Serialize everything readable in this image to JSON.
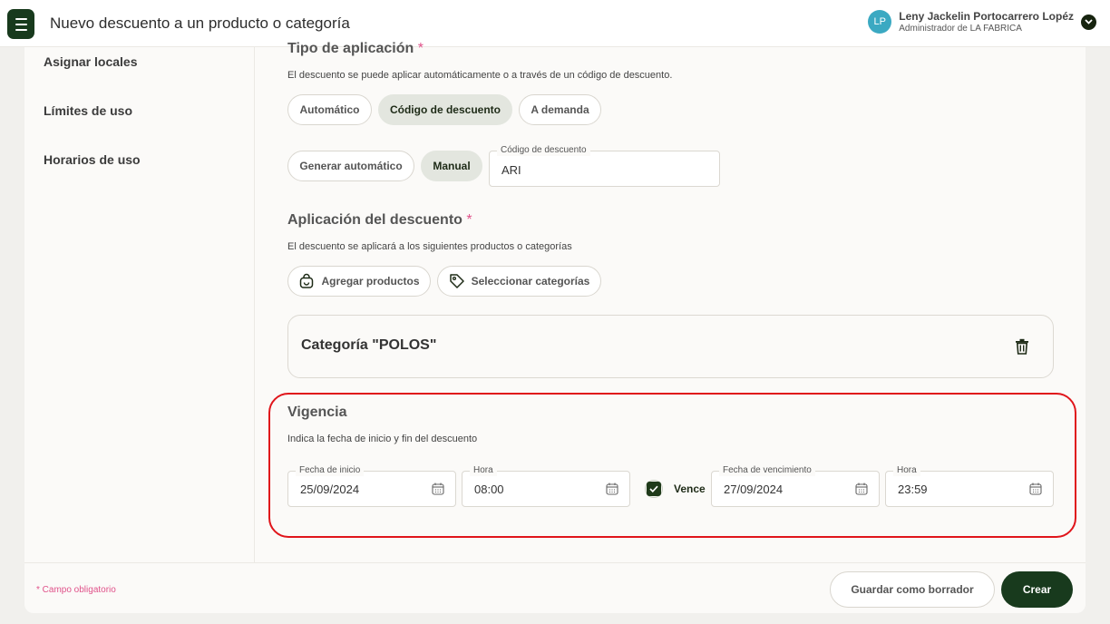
{
  "header": {
    "title": "Nuevo descuento a un producto o categoría",
    "user_initials": "LP",
    "user_name": "Leny Jackelin Portocarrero Lopéz",
    "user_role": "Administrador de LA FABRICA"
  },
  "sidebar": {
    "items": [
      {
        "label": "Asignar locales"
      },
      {
        "label": "Límites de uso"
      },
      {
        "label": "Horarios de uso"
      }
    ]
  },
  "tipo_aplicacion": {
    "title": "Tipo de aplicación",
    "required_mark": "*",
    "description": "El descuento se puede aplicar automáticamente o a través de un código de descuento.",
    "options": [
      "Automático",
      "Código de descuento",
      "A demanda"
    ],
    "selected": "Código de descuento",
    "code_modes": [
      "Generar automático",
      "Manual"
    ],
    "code_mode_selected": "Manual",
    "code_field_label": "Código de descuento",
    "code_field_value": "ARI"
  },
  "aplicacion": {
    "title": "Aplicación del descuento",
    "required_mark": "*",
    "description": "El descuento se aplicará a los siguientes productos o categorías",
    "add_products_label": "Agregar productos",
    "select_categories_label": "Seleccionar categorías",
    "selected_category": "Categoría \"POLOS\""
  },
  "vigencia": {
    "title": "Vigencia",
    "description": "Indica la fecha de inicio y fin del descuento",
    "start_date_label": "Fecha de inicio",
    "start_date_value": "25/09/2024",
    "start_time_label": "Hora",
    "start_time_value": "08:00",
    "expires_label": "Vence",
    "expires_checked": true,
    "end_date_label": "Fecha de vencimiento",
    "end_date_value": "27/09/2024",
    "end_time_label": "Hora",
    "end_time_value": "23:59"
  },
  "footer": {
    "required_note": "* Campo obligatorio",
    "save_draft_label": "Guardar como borrador",
    "create_label": "Crear"
  },
  "colors": {
    "primary": "#183a1d",
    "accent_pink": "#e0528a",
    "highlight_red": "#e0151b",
    "avatar": "#3ba9c2"
  }
}
